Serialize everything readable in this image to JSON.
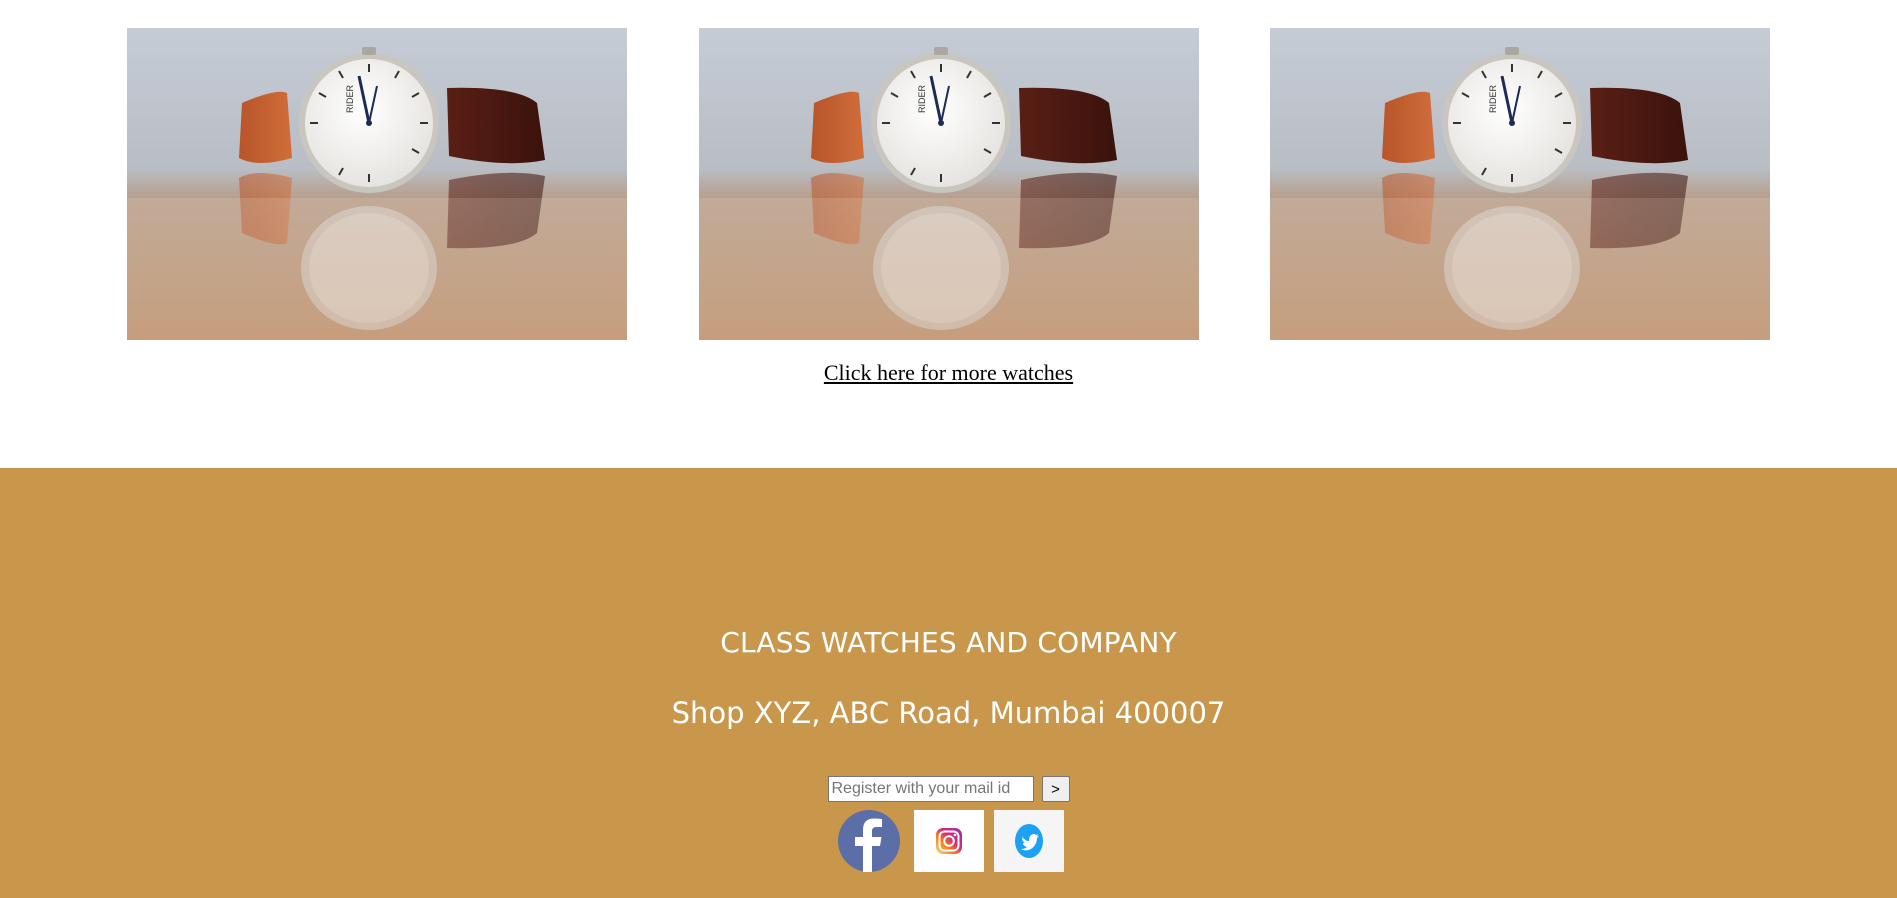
{
  "gallery": {
    "items": [
      {
        "image": "watch-photo",
        "alt": "Wristwatch with brown leather strap"
      },
      {
        "image": "watch-photo",
        "alt": "Wristwatch with brown leather strap"
      },
      {
        "image": "watch-photo",
        "alt": "Wristwatch with brown leather strap"
      }
    ],
    "brand": "RIDER"
  },
  "more_link": {
    "label": "Click here for more watches"
  },
  "footer": {
    "background": "#c9974c",
    "company_name": "CLASS WATCHES AND COMPANY",
    "address": "Shop XYZ, ABC Road, Mumbai 400007",
    "register": {
      "placeholder": "Register with your mail id",
      "value": "",
      "submit_label": ">"
    },
    "social": [
      {
        "name": "facebook-icon",
        "color": "#5b6ea8"
      },
      {
        "name": "instagram-icon",
        "color": "#d6249f"
      },
      {
        "name": "twitter-icon",
        "color": "#1da1f2"
      }
    ]
  }
}
